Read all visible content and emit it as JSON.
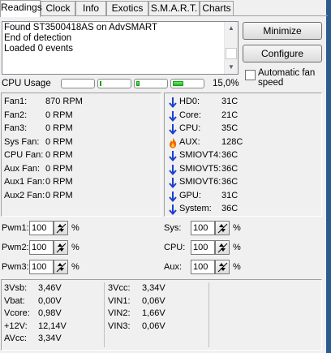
{
  "tabs": [
    {
      "label": "Readings",
      "active": true
    },
    {
      "label": "Clock",
      "active": false
    },
    {
      "label": "Info",
      "active": false
    },
    {
      "label": "Exotics",
      "active": false
    },
    {
      "label": "S.M.A.R.T.",
      "active": false
    },
    {
      "label": "Charts",
      "active": false
    }
  ],
  "log": {
    "lines": [
      "Found ST3500418AS on AdvSMART",
      "End of detection",
      "Loaded 0 events"
    ]
  },
  "buttons": {
    "minimize": "Minimize",
    "configure": "Configure"
  },
  "auto_fan": {
    "label_line1": "Automatic fan",
    "label_line2": "speed",
    "checked": false
  },
  "cpu_usage": {
    "label": "CPU Usage",
    "percent_text": "15,0%",
    "core_levels": [
      0.0,
      0.05,
      0.1,
      0.35
    ]
  },
  "fans": [
    {
      "name": "Fan1:",
      "value": "870 RPM"
    },
    {
      "name": "Fan2:",
      "value": "0 RPM"
    },
    {
      "name": "Fan3:",
      "value": "0 RPM"
    },
    {
      "name": "Sys Fan:",
      "value": "0 RPM"
    },
    {
      "name": "CPU Fan:",
      "value": "0 RPM"
    },
    {
      "name": "Aux Fan:",
      "value": "0 RPM"
    },
    {
      "name": "Aux1 Fan:",
      "value": "0 RPM"
    },
    {
      "name": "Aux2 Fan:",
      "value": "0 RPM"
    }
  ],
  "temps": [
    {
      "name": "HD0:",
      "value": "31C",
      "icon": "down-arrow-icon"
    },
    {
      "name": "Core:",
      "value": "21C",
      "icon": "down-arrow-icon"
    },
    {
      "name": "CPU:",
      "value": "35C",
      "icon": "down-arrow-icon"
    },
    {
      "name": "AUX:",
      "value": "128C",
      "icon": "flame-icon"
    },
    {
      "name": "SMIOVT4:",
      "value": "36C",
      "icon": "down-arrow-icon"
    },
    {
      "name": "SMIOVT5:",
      "value": "36C",
      "icon": "down-arrow-icon"
    },
    {
      "name": "SMIOVT6:",
      "value": "36C",
      "icon": "down-arrow-icon"
    },
    {
      "name": "GPU:",
      "value": "31C",
      "icon": "down-arrow-icon"
    },
    {
      "name": "System:",
      "value": "36C",
      "icon": "down-arrow-icon"
    }
  ],
  "pwm_left": [
    {
      "label": "Pwm1:",
      "value": "100",
      "unit": "%"
    },
    {
      "label": "Pwm2:",
      "value": "100",
      "unit": "%"
    },
    {
      "label": "Pwm3:",
      "value": "100",
      "unit": "%"
    }
  ],
  "pwm_right": [
    {
      "label": "Sys:",
      "value": "100",
      "unit": "%"
    },
    {
      "label": "CPU:",
      "value": "100",
      "unit": "%"
    },
    {
      "label": "Aux:",
      "value": "100",
      "unit": "%"
    }
  ],
  "voltages_col1": [
    {
      "name": "3Vsb:",
      "value": "3,46V"
    },
    {
      "name": "Vbat:",
      "value": "0,00V"
    },
    {
      "name": "Vcore:",
      "value": "0,98V"
    },
    {
      "name": "+12V:",
      "value": "12,14V"
    },
    {
      "name": "AVcc:",
      "value": "3,34V"
    }
  ],
  "voltages_col2": [
    {
      "name": "3Vcc:",
      "value": "3,34V"
    },
    {
      "name": "VIN1:",
      "value": "0,06V"
    },
    {
      "name": "VIN2:",
      "value": "1,66V"
    },
    {
      "name": "VIN3:",
      "value": "0,06V"
    }
  ],
  "colors": {
    "arrow_blue": "#1a3ecf",
    "flame_orange": "#f06a00",
    "meter_green": "#1eb91e"
  }
}
